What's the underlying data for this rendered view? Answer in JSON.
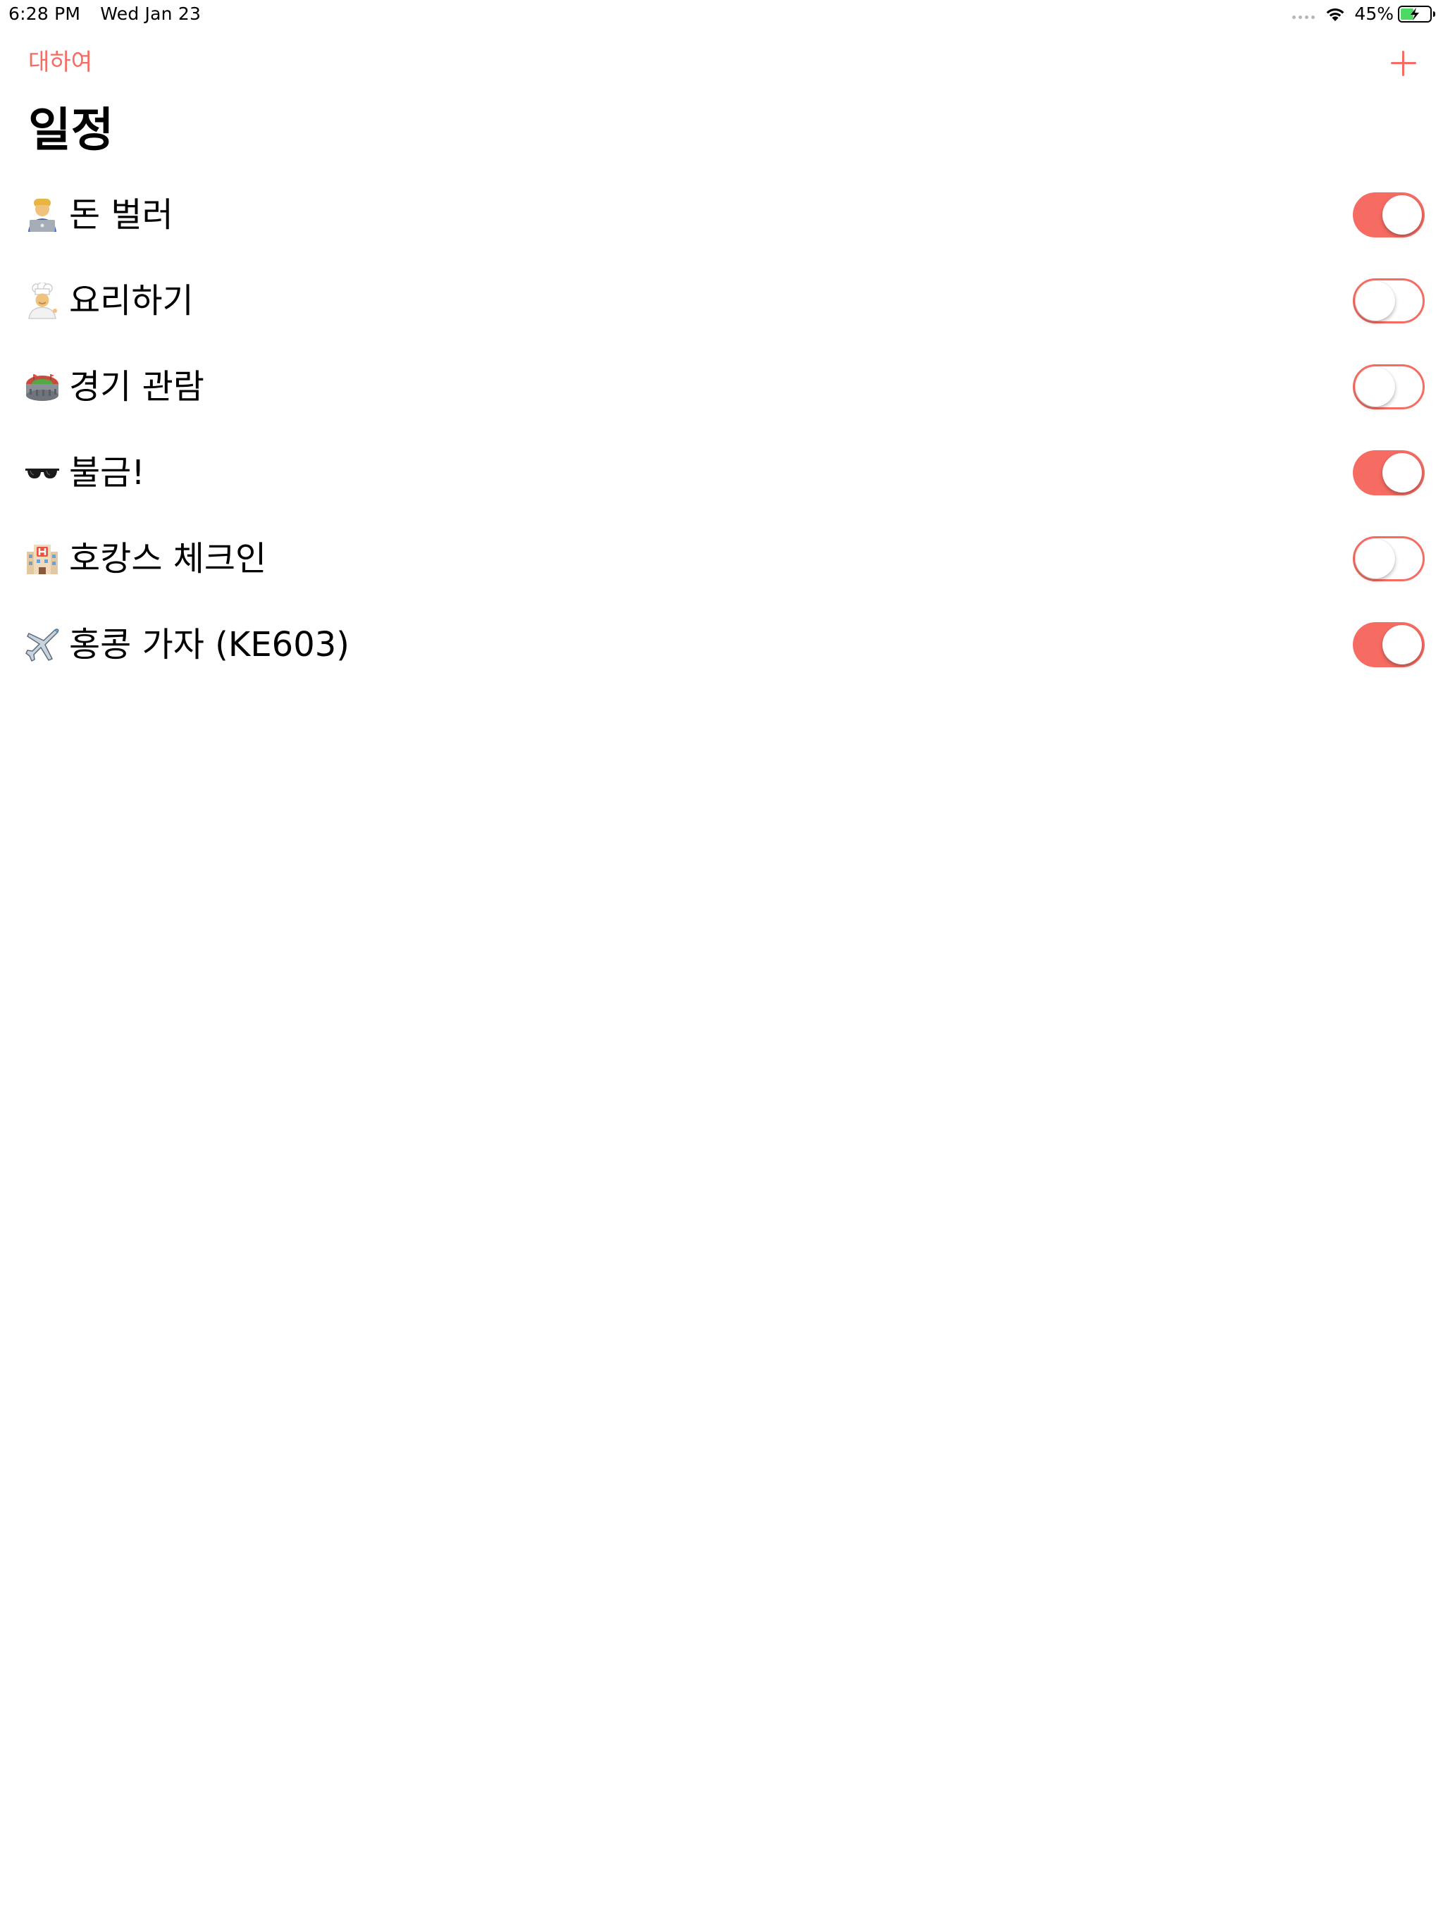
{
  "status_bar": {
    "time": "6:28 PM",
    "date": "Wed Jan 23",
    "battery_percent": "45%",
    "battery_level": 0.45,
    "battery_charging": true
  },
  "nav": {
    "back_label": "대하여",
    "add_icon": "plus-icon"
  },
  "title": "일정",
  "colors": {
    "accent": "#f76c62",
    "text": "#000000",
    "background": "#ffffff"
  },
  "items": [
    {
      "icon": "technologist-icon",
      "emoji": "👨‍💻",
      "label": "돈 벌러",
      "enabled": true
    },
    {
      "icon": "cook-icon",
      "emoji": "👨‍🍳",
      "label": "요리하기",
      "enabled": false
    },
    {
      "icon": "stadium-icon",
      "emoji": "🏟️",
      "label": "경기 관람",
      "enabled": false
    },
    {
      "icon": "sunglasses-icon",
      "emoji": "🕶️",
      "label": "불금!",
      "enabled": true
    },
    {
      "icon": "hotel-icon",
      "emoji": "🏨",
      "label": "호캉스 체크인",
      "enabled": false
    },
    {
      "icon": "airplane-icon",
      "emoji": "✈️",
      "label": "홍콩 가자 (KE603)",
      "enabled": true
    }
  ]
}
